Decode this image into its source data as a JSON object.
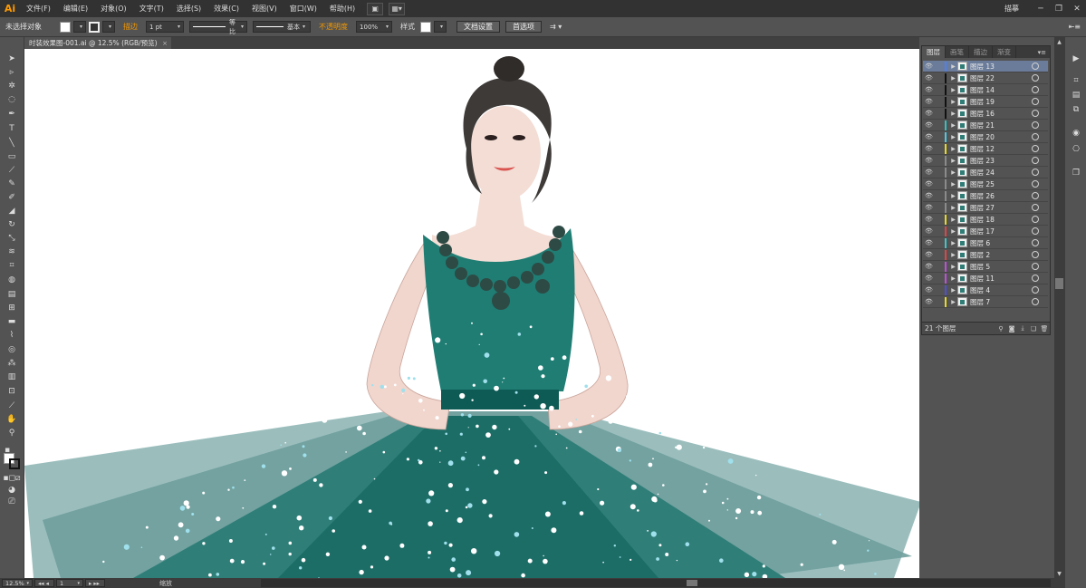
{
  "app": {
    "logo": "Ai",
    "menu": [
      "文件(F)",
      "编辑(E)",
      "对象(O)",
      "文字(T)",
      "选择(S)",
      "效果(C)",
      "视图(V)",
      "窗口(W)",
      "帮助(H)"
    ],
    "workspace": "描摹",
    "window_buttons": [
      "─",
      "❐",
      "✕"
    ]
  },
  "control_bar": {
    "selection": "未选择对象",
    "stroke_label": "描边",
    "stroke_weight": "1 pt",
    "profile": "等比",
    "brush": "基本",
    "opacity_label": "不透明度",
    "opacity": "100%",
    "style_label": "样式",
    "doc_setup": "文档设置",
    "preferences": "首选项"
  },
  "document": {
    "tab_title": "时装效果图-001.ai @ 12.5% (RGB/预览)",
    "close": "×"
  },
  "layers_panel": {
    "tabs": [
      "图层",
      "画笔",
      "描边",
      "渐变"
    ],
    "active_tab": "图层",
    "menu": "▾≡",
    "layers": [
      {
        "name": "图层 13",
        "color": "#4f7ff0",
        "selected": true
      },
      {
        "name": "图层 22",
        "color": "#111111"
      },
      {
        "name": "图层 14",
        "color": "#111111"
      },
      {
        "name": "图层 19",
        "color": "#111111"
      },
      {
        "name": "图层 16",
        "color": "#111111"
      },
      {
        "name": "图层 21",
        "color": "#36c0c0"
      },
      {
        "name": "图层 20",
        "color": "#4fc9e0"
      },
      {
        "name": "图层 12",
        "color": "#e6d829"
      },
      {
        "name": "图层 23",
        "color": "#8b8b8b"
      },
      {
        "name": "图层 24",
        "color": "#8b8b8b"
      },
      {
        "name": "图层 25",
        "color": "#8b8b8b"
      },
      {
        "name": "图层 26",
        "color": "#8b8b8b"
      },
      {
        "name": "图层 27",
        "color": "#8b8b8b"
      },
      {
        "name": "图层 18",
        "color": "#e6d829"
      },
      {
        "name": "图层 17",
        "color": "#e04545"
      },
      {
        "name": "图层 6",
        "color": "#3fc7c7"
      },
      {
        "name": "图层 2",
        "color": "#e04545"
      },
      {
        "name": "图层 5",
        "color": "#c04fd9"
      },
      {
        "name": "图层 11",
        "color": "#c04fd9"
      },
      {
        "name": "图层 4",
        "color": "#4f4fd9"
      },
      {
        "name": "图层 7",
        "color": "#e6d829"
      }
    ],
    "count": "21 个图层"
  },
  "status_bar": {
    "zoom": "12.5%",
    "artboard": "1",
    "tool": "缩放"
  },
  "colors": {
    "dress": "#1f7d74",
    "dress_dark": "#0e5a54",
    "skirt_light": "#8ab3b1",
    "accent": "#f39800"
  }
}
